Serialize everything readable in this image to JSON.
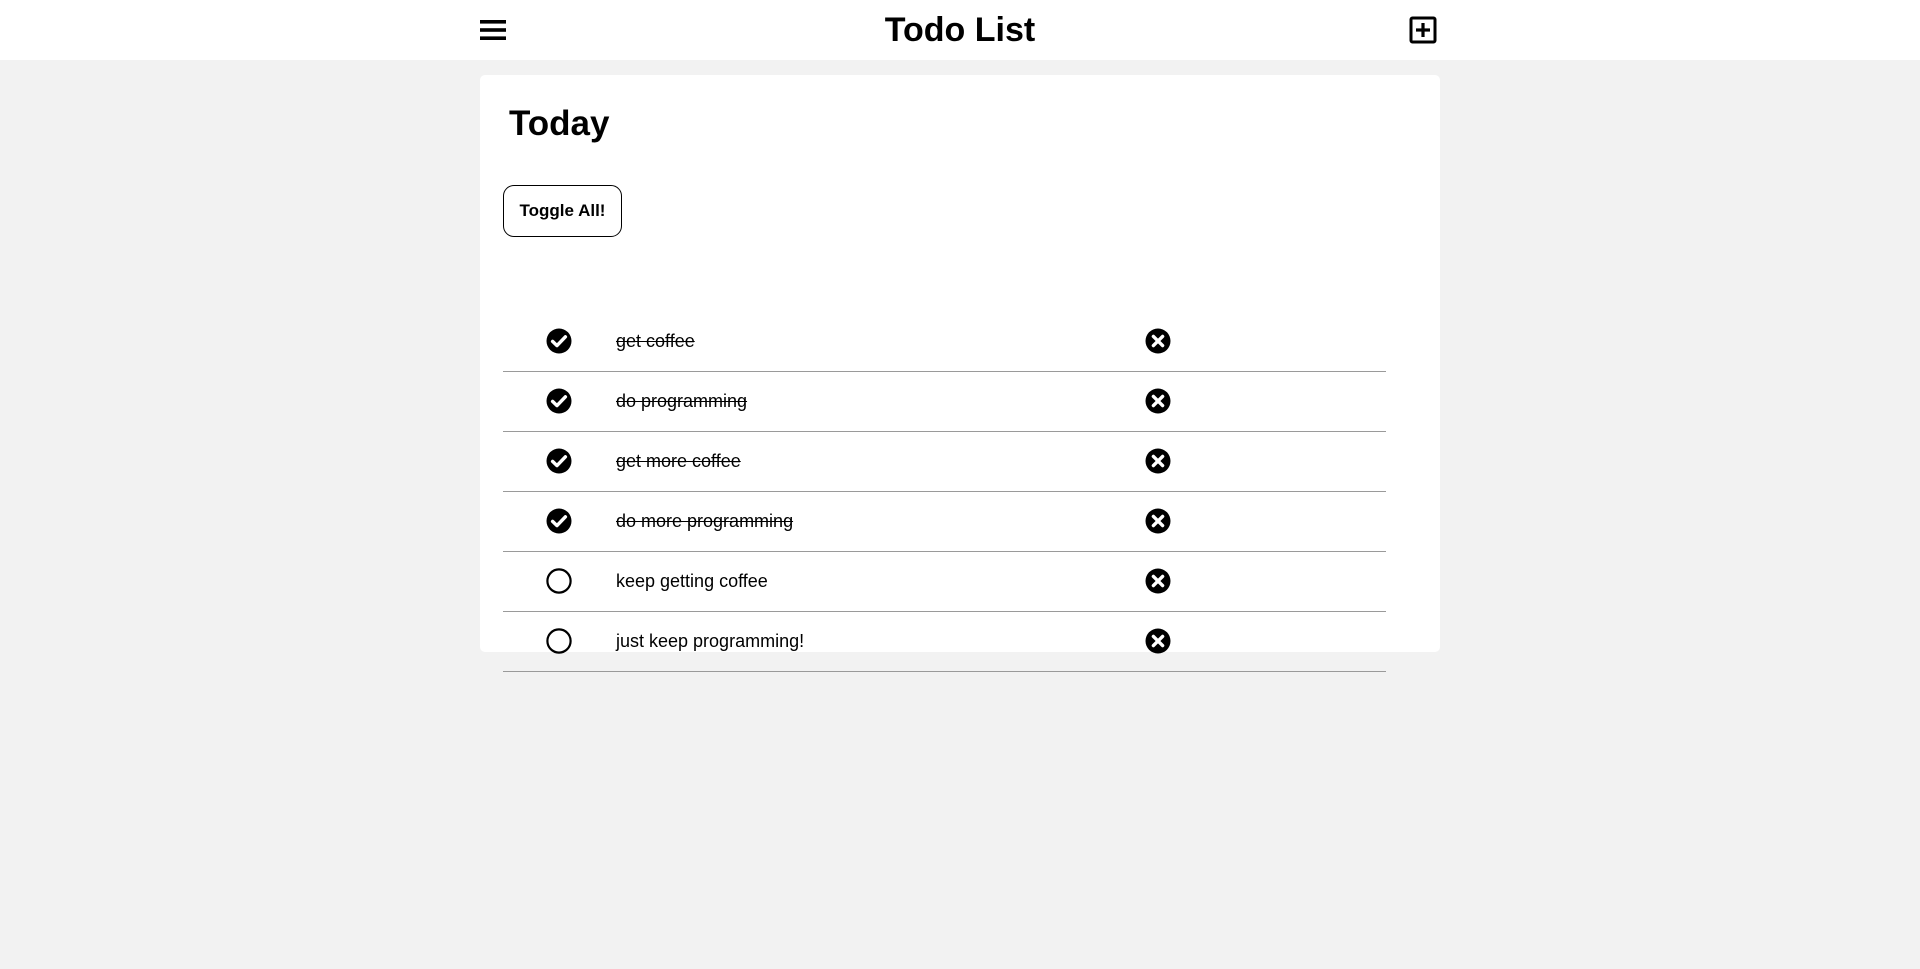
{
  "header": {
    "title": "Todo List",
    "menu_icon": "hamburger-menu-icon",
    "add_icon": "plus-square-icon"
  },
  "main": {
    "section_title": "Today",
    "toggle_all_label": "Toggle All!",
    "todos": [
      {
        "text": "get coffee",
        "done": true
      },
      {
        "text": "do programming",
        "done": true
      },
      {
        "text": "get more coffee",
        "done": true
      },
      {
        "text": "do more programming",
        "done": true
      },
      {
        "text": "keep getting coffee",
        "done": false
      },
      {
        "text": "just keep programming!",
        "done": false
      }
    ]
  },
  "colors": {
    "page_background": "#f2f2f2",
    "surface": "#ffffff",
    "text": "#000000",
    "divider": "#9a9a9a"
  }
}
